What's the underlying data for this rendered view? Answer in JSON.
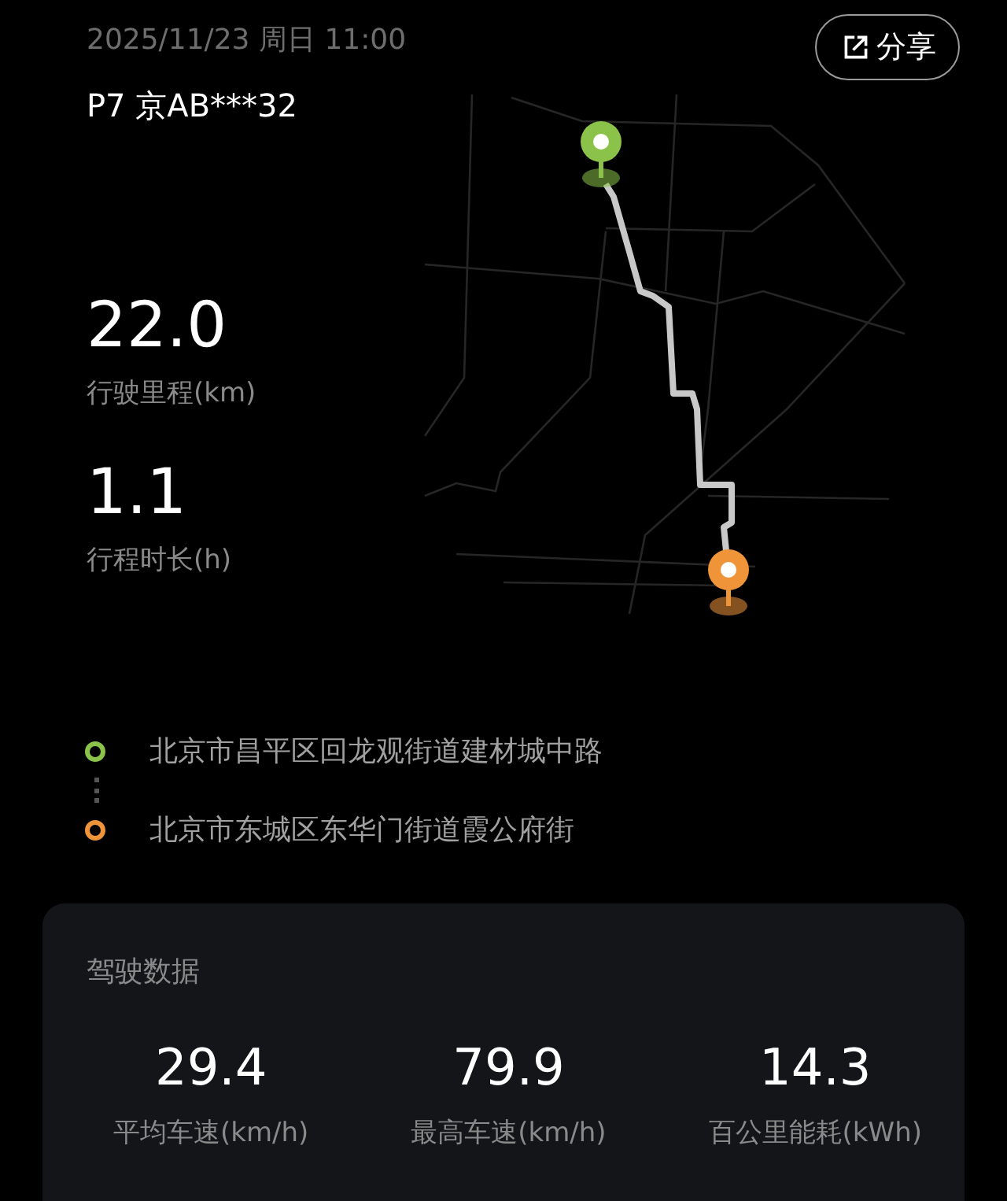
{
  "header": {
    "datetime": "2025/11/23 周日 11:00",
    "vehicle": "P7 京AB***32",
    "share_button": {
      "label": "分享"
    }
  },
  "trip_stats": [
    {
      "value": "22.0",
      "label": "行驶里程(km)"
    },
    {
      "value": "1.1",
      "label": "行程时长(h)"
    }
  ],
  "locations": [
    {
      "address": "北京市昌平区回龙观街道建材城中路",
      "color": "#8bc34a"
    },
    {
      "address": "北京市东城区东华门街道霞公府街",
      "color": "#f0943a"
    }
  ],
  "driving_data": {
    "title": "驾驶数据",
    "metrics": [
      {
        "value": "29.4",
        "label": "平均车速(km/h)"
      },
      {
        "value": "79.9",
        "label": "最高车速(km/h)"
      },
      {
        "value": "14.3",
        "label": "百公里能耗(kWh)"
      }
    ]
  }
}
